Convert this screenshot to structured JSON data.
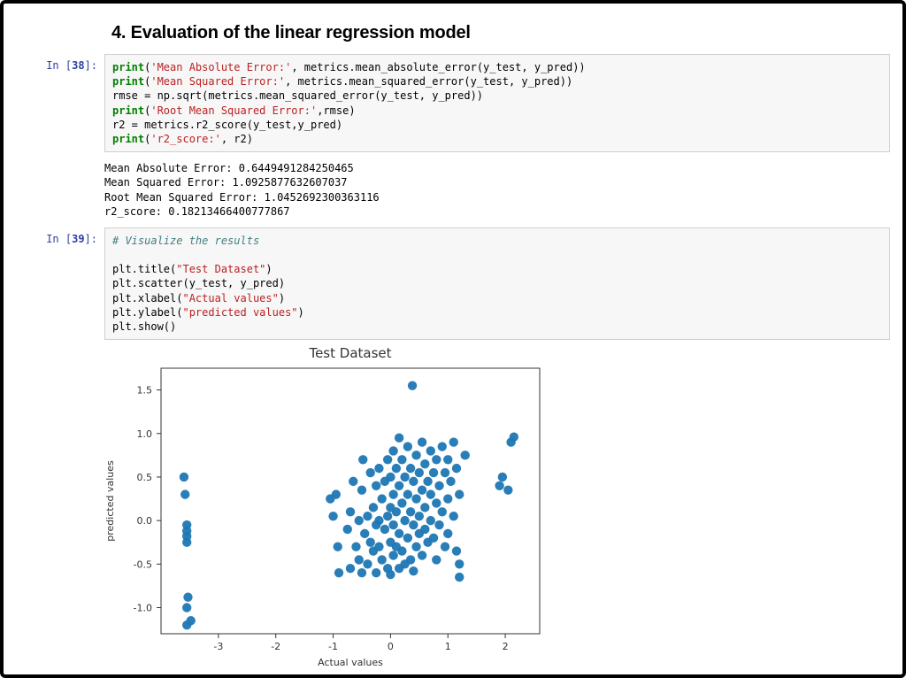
{
  "section_title": "4. Evaluation of the linear regression model",
  "cells": {
    "c38": {
      "prompt_num": "38",
      "l1a": "print",
      "l1b": "(",
      "l1c": "'Mean Absolute Error:'",
      "l1d": ", metrics.mean_absolute_error(y_test, y_pred))",
      "l2a": "print",
      "l2b": "(",
      "l2c": "'Mean Squared Error:'",
      "l2d": ", metrics.mean_squared_error(y_test, y_pred))",
      "l3": "rmse = np.sqrt(metrics.mean_squared_error(y_test, y_pred))",
      "l4a": "print",
      "l4b": "(",
      "l4c": "'Root Mean Squared Error:'",
      "l4d": ",rmse)",
      "l5": "r2 = metrics.r2_score(y_test,y_pred)",
      "l6a": "print",
      "l6b": "(",
      "l6c": "'r2_score:'",
      "l6d": ", r2)"
    },
    "c38_out": "Mean Absolute Error: 0.6449491284250465\nMean Squared Error: 1.0925877632607037\nRoot Mean Squared Error: 1.0452692300363116\nr2_score: 0.18213466400777867",
    "c39": {
      "prompt_num": "39",
      "l1": "# Visualize the results",
      "blank": "",
      "l2": "plt.title(",
      "l2s": "\"Test Dataset\"",
      "l2e": ")",
      "l3": "plt.scatter(y_test, y_pred)",
      "l4": "plt.xlabel(",
      "l4s": "\"Actual values\"",
      "l4e": ")",
      "l5": "plt.ylabel(",
      "l5s": "\"predicted values\"",
      "l5e": ")",
      "l6": "plt.show()"
    }
  },
  "chart_data": {
    "type": "scatter",
    "title": "Test Dataset",
    "xlabel": "Actual values",
    "ylabel": "predicted values",
    "xlim": [
      -4.0,
      2.6
    ],
    "ylim": [
      -1.3,
      1.75
    ],
    "xticks": [
      -3,
      -2,
      -1,
      0,
      1,
      2
    ],
    "yticks": [
      -1.0,
      -0.5,
      0.0,
      0.5,
      1.0,
      1.5
    ],
    "points": [
      [
        -3.6,
        0.5
      ],
      [
        -3.58,
        0.3
      ],
      [
        -3.55,
        -0.05
      ],
      [
        -3.55,
        -0.12
      ],
      [
        -3.55,
        -0.18
      ],
      [
        -3.55,
        -0.25
      ],
      [
        -3.53,
        -0.88
      ],
      [
        -3.55,
        -1.0
      ],
      [
        -3.48,
        -1.15
      ],
      [
        -3.55,
        -1.2
      ],
      [
        -1.05,
        0.25
      ],
      [
        -1.0,
        0.05
      ],
      [
        -0.95,
        0.3
      ],
      [
        -0.9,
        -0.6
      ],
      [
        -0.92,
        -0.3
      ],
      [
        -0.75,
        -0.1
      ],
      [
        -0.7,
        0.1
      ],
      [
        -0.7,
        -0.55
      ],
      [
        -0.65,
        0.45
      ],
      [
        -0.6,
        -0.3
      ],
      [
        -0.55,
        0.0
      ],
      [
        -0.55,
        -0.45
      ],
      [
        -0.5,
        0.35
      ],
      [
        -0.5,
        -0.6
      ],
      [
        -0.48,
        0.7
      ],
      [
        -0.45,
        -0.15
      ],
      [
        -0.4,
        0.05
      ],
      [
        -0.4,
        -0.5
      ],
      [
        -0.35,
        0.55
      ],
      [
        -0.35,
        -0.25
      ],
      [
        -0.3,
        0.15
      ],
      [
        -0.3,
        -0.35
      ],
      [
        -0.25,
        0.4
      ],
      [
        -0.25,
        -0.05
      ],
      [
        -0.25,
        -0.6
      ],
      [
        -0.2,
        0.6
      ],
      [
        -0.2,
        0.0
      ],
      [
        -0.2,
        -0.3
      ],
      [
        -0.15,
        0.25
      ],
      [
        -0.15,
        -0.45
      ],
      [
        -0.1,
        0.45
      ],
      [
        -0.1,
        -0.1
      ],
      [
        -0.05,
        0.7
      ],
      [
        -0.05,
        0.05
      ],
      [
        -0.05,
        -0.55
      ],
      [
        0.0,
        0.5
      ],
      [
        0.0,
        0.15
      ],
      [
        0.0,
        -0.25
      ],
      [
        0.0,
        -0.62
      ],
      [
        0.05,
        0.8
      ],
      [
        0.05,
        0.3
      ],
      [
        0.05,
        -0.05
      ],
      [
        0.05,
        -0.4
      ],
      [
        0.1,
        0.6
      ],
      [
        0.1,
        0.1
      ],
      [
        0.1,
        -0.3
      ],
      [
        0.15,
        0.95
      ],
      [
        0.15,
        0.4
      ],
      [
        0.15,
        -0.15
      ],
      [
        0.15,
        -0.55
      ],
      [
        0.2,
        0.7
      ],
      [
        0.2,
        0.2
      ],
      [
        0.2,
        -0.35
      ],
      [
        0.25,
        0.5
      ],
      [
        0.25,
        0.0
      ],
      [
        0.25,
        -0.5
      ],
      [
        0.3,
        0.85
      ],
      [
        0.3,
        0.3
      ],
      [
        0.3,
        -0.2
      ],
      [
        0.35,
        0.6
      ],
      [
        0.35,
        0.1
      ],
      [
        0.35,
        -0.45
      ],
      [
        0.38,
        1.55
      ],
      [
        0.4,
        0.45
      ],
      [
        0.4,
        -0.05
      ],
      [
        0.4,
        -0.58
      ],
      [
        0.45,
        0.75
      ],
      [
        0.45,
        0.25
      ],
      [
        0.45,
        -0.3
      ],
      [
        0.5,
        0.55
      ],
      [
        0.5,
        0.05
      ],
      [
        0.5,
        -0.15
      ],
      [
        0.55,
        0.9
      ],
      [
        0.55,
        0.35
      ],
      [
        0.55,
        -0.4
      ],
      [
        0.6,
        0.65
      ],
      [
        0.6,
        0.15
      ],
      [
        0.6,
        -0.1
      ],
      [
        0.65,
        0.45
      ],
      [
        0.65,
        -0.25
      ],
      [
        0.7,
        0.8
      ],
      [
        0.7,
        0.3
      ],
      [
        0.7,
        0.0
      ],
      [
        0.75,
        0.55
      ],
      [
        0.75,
        -0.2
      ],
      [
        0.8,
        0.7
      ],
      [
        0.8,
        0.2
      ],
      [
        0.8,
        -0.45
      ],
      [
        0.85,
        0.4
      ],
      [
        0.85,
        -0.05
      ],
      [
        0.9,
        0.85
      ],
      [
        0.9,
        0.1
      ],
      [
        0.95,
        0.55
      ],
      [
        0.95,
        -0.3
      ],
      [
        1.0,
        0.7
      ],
      [
        1.0,
        0.25
      ],
      [
        1.0,
        -0.15
      ],
      [
        1.05,
        0.45
      ],
      [
        1.1,
        0.9
      ],
      [
        1.1,
        0.05
      ],
      [
        1.15,
        0.6
      ],
      [
        1.15,
        -0.35
      ],
      [
        1.2,
        0.3
      ],
      [
        1.2,
        -0.5
      ],
      [
        1.2,
        -0.65
      ],
      [
        1.3,
        0.75
      ],
      [
        1.9,
        0.4
      ],
      [
        1.95,
        0.5
      ],
      [
        2.05,
        0.35
      ],
      [
        2.1,
        0.9
      ],
      [
        2.15,
        0.96
      ]
    ]
  }
}
